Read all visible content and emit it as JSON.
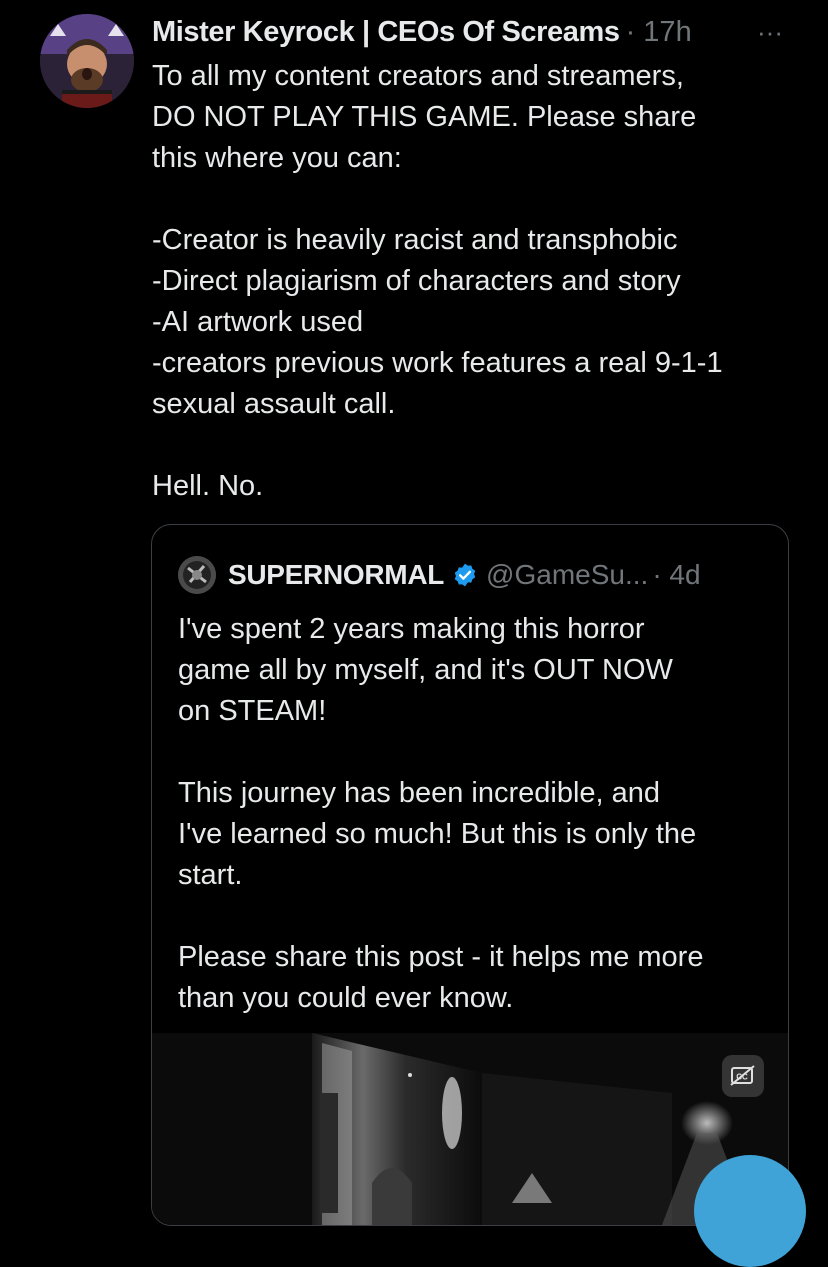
{
  "tweet": {
    "author_name": "Mister Keyrock | CEOs Of Screams",
    "time": "· 17h",
    "more_icon": "···",
    "lines": [
      "To all my content creators and streamers,",
      "DO NOT PLAY THIS GAME. Please share",
      "this where you can:",
      "",
      "-Creator is heavily racist and transphobic",
      "-Direct plagiarism of characters and story",
      "-AI artwork used",
      "-creators previous work features a real 9-1-1",
      "sexual assault call.",
      "",
      "Hell. No."
    ]
  },
  "quote": {
    "name": "SUPERNORMAL",
    "handle": "@GameSu...",
    "time": "· 4d",
    "verified_color": "#1d9bf0",
    "lines": [
      "I've spent 2 years making this horror",
      "game all by myself, and it's OUT NOW",
      "on STEAM!",
      "",
      "This journey has been incredible, and",
      "I've learned so much! But this is only the",
      "start.",
      "",
      "Please share this post - it helps me more",
      "than you could ever know."
    ]
  },
  "media": {
    "cc_icon": "closed-captions-off-icon"
  },
  "colors": {
    "background": "#000000",
    "text": "#e7e9ea",
    "muted": "#71767b",
    "accent": "#1d9bf0",
    "fab": "#3fa3d8"
  }
}
